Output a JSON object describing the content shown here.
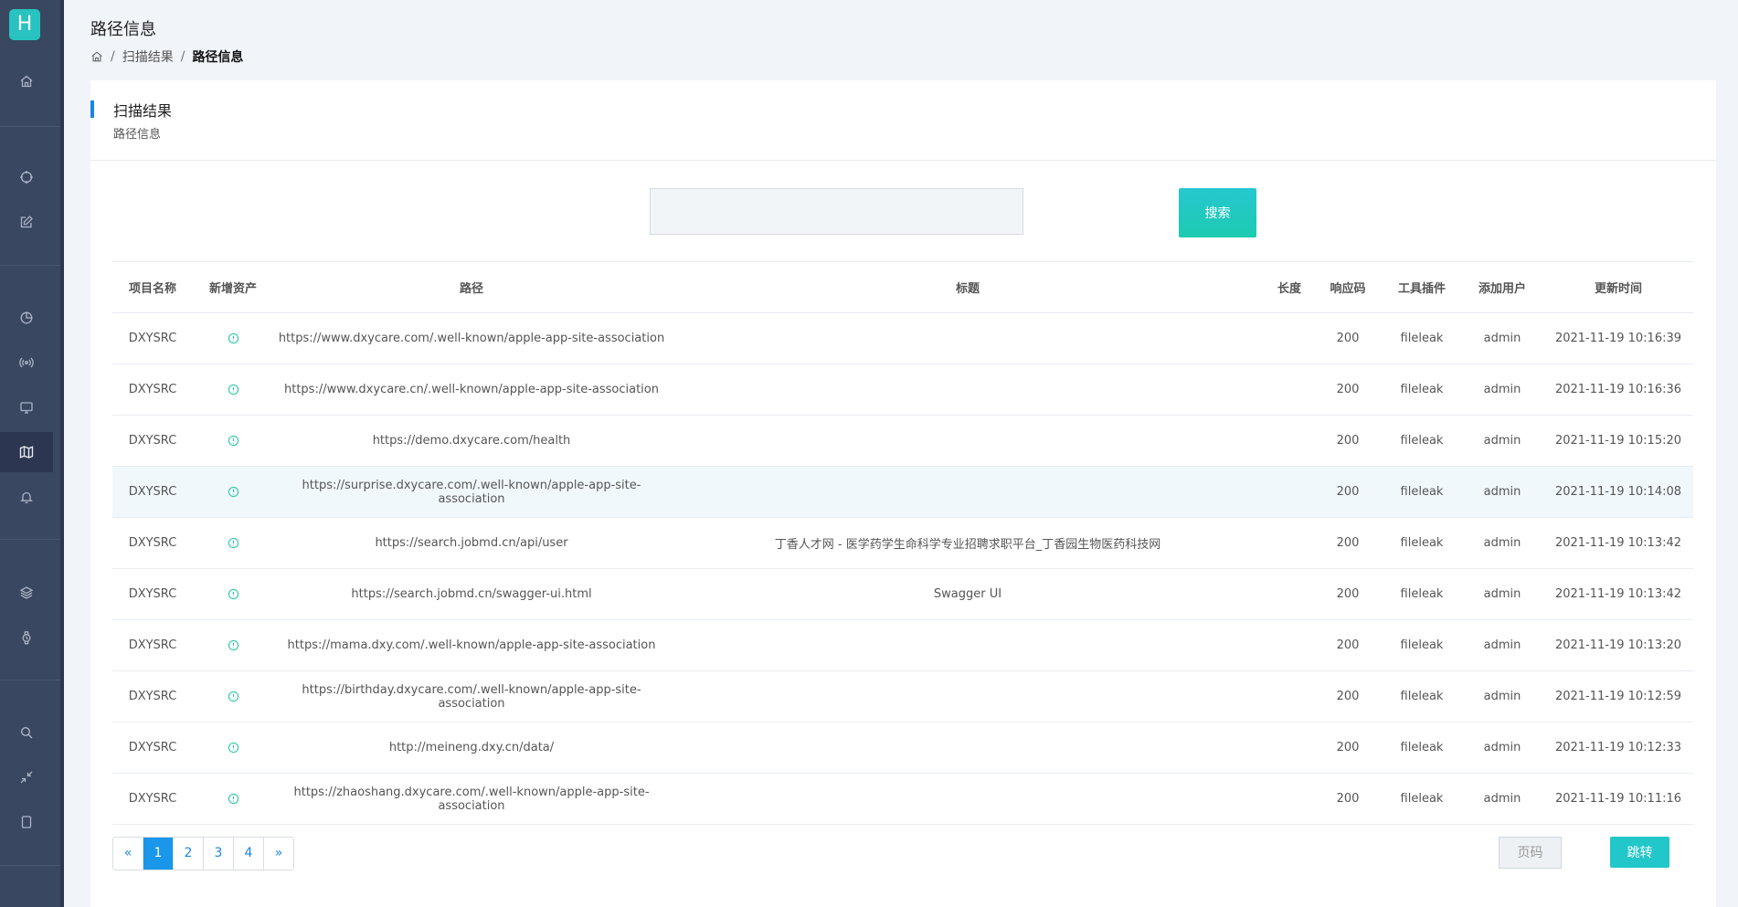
{
  "app": {
    "logo_letter": "H"
  },
  "header": {
    "title": "路径信息",
    "breadcrumb": {
      "separator": "/",
      "items": [
        "扫描结果",
        "路径信息"
      ]
    }
  },
  "card": {
    "title": "扫描结果",
    "subtitle": "路径信息"
  },
  "search": {
    "placeholder": "",
    "value": "",
    "button_label": "搜索"
  },
  "table": {
    "columns": [
      "项目名称",
      "新增资产",
      "路径",
      "标题",
      "长度",
      "响应码",
      "工具插件",
      "添加用户",
      "更新时间"
    ],
    "rows": [
      {
        "project": "DXYSRC",
        "path": "https://www.dxycare.com/.well-known/apple-app-site-association",
        "title": "",
        "length": "",
        "code": "200",
        "plugin": "fileleak",
        "user": "admin",
        "time": "2021-11-19 10:16:39"
      },
      {
        "project": "DXYSRC",
        "path": "https://www.dxycare.cn/.well-known/apple-app-site-association",
        "title": "",
        "length": "",
        "code": "200",
        "plugin": "fileleak",
        "user": "admin",
        "time": "2021-11-19 10:16:36"
      },
      {
        "project": "DXYSRC",
        "path": "https://demo.dxycare.com/health",
        "title": "",
        "length": "",
        "code": "200",
        "plugin": "fileleak",
        "user": "admin",
        "time": "2021-11-19 10:15:20"
      },
      {
        "project": "DXYSRC",
        "path": "https://surprise.dxycare.com/.well-known/apple-app-site-association",
        "title": "",
        "length": "",
        "code": "200",
        "plugin": "fileleak",
        "user": "admin",
        "time": "2021-11-19 10:14:08"
      },
      {
        "project": "DXYSRC",
        "path": "https://search.jobmd.cn/api/user",
        "title": "丁香人才网 - 医学药学生命科学专业招聘求职平台_丁香园生物医药科技网",
        "length": "",
        "code": "200",
        "plugin": "fileleak",
        "user": "admin",
        "time": "2021-11-19 10:13:42"
      },
      {
        "project": "DXYSRC",
        "path": "https://search.jobmd.cn/swagger-ui.html",
        "title": "Swagger UI",
        "length": "",
        "code": "200",
        "plugin": "fileleak",
        "user": "admin",
        "time": "2021-11-19 10:13:42"
      },
      {
        "project": "DXYSRC",
        "path": "https://mama.dxy.com/.well-known/apple-app-site-association",
        "title": "",
        "length": "",
        "code": "200",
        "plugin": "fileleak",
        "user": "admin",
        "time": "2021-11-19 10:13:20"
      },
      {
        "project": "DXYSRC",
        "path": "https://birthday.dxycare.com/.well-known/apple-app-site-association",
        "title": "",
        "length": "",
        "code": "200",
        "plugin": "fileleak",
        "user": "admin",
        "time": "2021-11-19 10:12:59"
      },
      {
        "project": "DXYSRC",
        "path": "http://meineng.dxy.cn/data/",
        "title": "",
        "length": "",
        "code": "200",
        "plugin": "fileleak",
        "user": "admin",
        "time": "2021-11-19 10:12:33"
      },
      {
        "project": "DXYSRC",
        "path": "https://zhaoshang.dxycare.com/.well-known/apple-app-site-association",
        "title": "",
        "length": "",
        "code": "200",
        "plugin": "fileleak",
        "user": "admin",
        "time": "2021-11-19 10:11:16"
      }
    ]
  },
  "pagination": {
    "prev": "«",
    "next": "»",
    "pages": [
      "1",
      "2",
      "3",
      "4"
    ],
    "current": "1"
  },
  "jump": {
    "placeholder": "页码",
    "button_label": "跳转"
  },
  "colors": {
    "accent": "#1a96ea",
    "teal": "#21c7c9",
    "sidebar": "#3a4760",
    "new_asset_icon": "#2fc9a6"
  }
}
